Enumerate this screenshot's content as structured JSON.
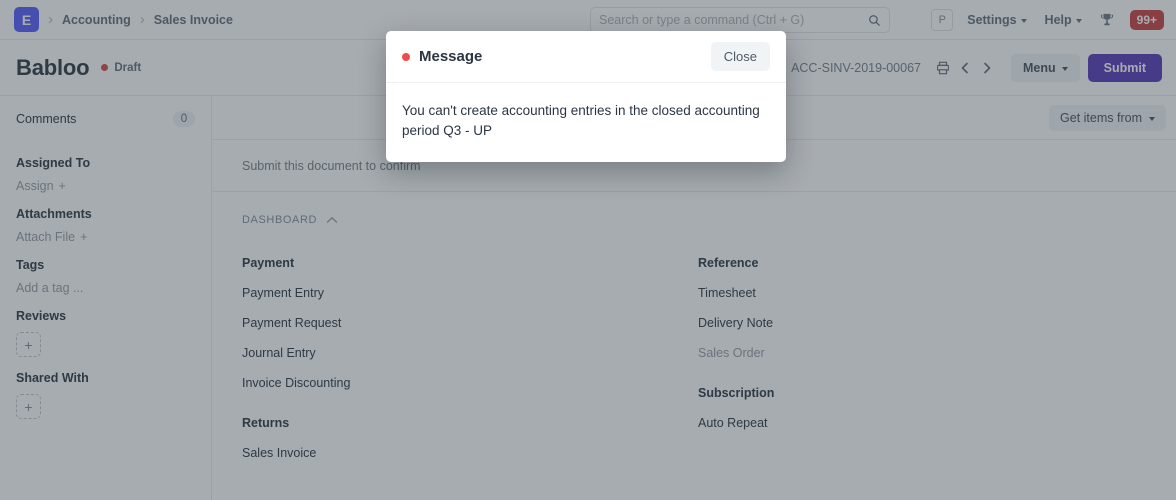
{
  "navbar": {
    "logo_letter": "E",
    "breadcrumbs": [
      "Accounting",
      "Sales Invoice"
    ],
    "search": {
      "placeholder": "Search or type a command (Ctrl + G)",
      "value": "",
      "icon": "search-icon"
    },
    "avatar_letter": "P",
    "menus": [
      {
        "label": "Settings",
        "icon": "chevron-down-icon"
      },
      {
        "label": "Help",
        "icon": "chevron-down-icon"
      }
    ],
    "trophy_icon": "trophy-icon",
    "notification_badge": "99+",
    "notification_color": "#cc4a4a"
  },
  "title_bar": {
    "title": "Babloo",
    "status": "Draft",
    "status_color": "#d9534f",
    "doc_id": "ACC-SINV-2019-00067",
    "print_icon": "printer-icon",
    "prev_icon": "chevron-left-icon",
    "next_icon": "chevron-right-icon",
    "menu_label": "Menu",
    "submit_label": "Submit",
    "submit_color": "#5e44bd"
  },
  "sidebar": {
    "comments": {
      "label": "Comments",
      "count": "0"
    },
    "groups": [
      {
        "title": "Assigned To",
        "action": "Assign",
        "action_icon": "plus-icon"
      },
      {
        "title": "Attachments",
        "action": "Attach File",
        "action_icon": "plus-icon"
      },
      {
        "title": "Tags",
        "action": "Add a tag ...",
        "action_icon": ""
      },
      {
        "title": "Reviews",
        "action": "",
        "action_icon": "plus-box-icon"
      },
      {
        "title": "Shared With",
        "action": "",
        "action_icon": "plus-box-icon"
      }
    ]
  },
  "main": {
    "get_items_label": "Get items from",
    "get_items_icon": "chevron-down-icon",
    "hint": "Submit this document to confirm",
    "dashboard": {
      "heading": "DASHBOARD",
      "collapse_icon": "chevron-up-icon",
      "columns": [
        {
          "groups": [
            {
              "title": "Payment",
              "links": [
                {
                  "label": "Payment Entry",
                  "muted": false
                },
                {
                  "label": "Payment Request",
                  "muted": false
                },
                {
                  "label": "Journal Entry",
                  "muted": false
                },
                {
                  "label": "Invoice Discounting",
                  "muted": false
                }
              ]
            },
            {
              "title": "Returns",
              "links": [
                {
                  "label": "Sales Invoice",
                  "muted": false
                }
              ]
            }
          ]
        },
        {
          "groups": [
            {
              "title": "Reference",
              "links": [
                {
                  "label": "Timesheet",
                  "muted": false
                },
                {
                  "label": "Delivery Note",
                  "muted": false
                },
                {
                  "label": "Sales Order",
                  "muted": true
                }
              ]
            },
            {
              "title": "Subscription",
              "links": [
                {
                  "label": "Auto Repeat",
                  "muted": false
                }
              ]
            }
          ]
        }
      ]
    }
  },
  "modal": {
    "title": "Message",
    "indicator_color": "#ef4b4b",
    "close_label": "Close",
    "body": "You can't create accounting entries in the closed accounting period Q3 - UP"
  }
}
